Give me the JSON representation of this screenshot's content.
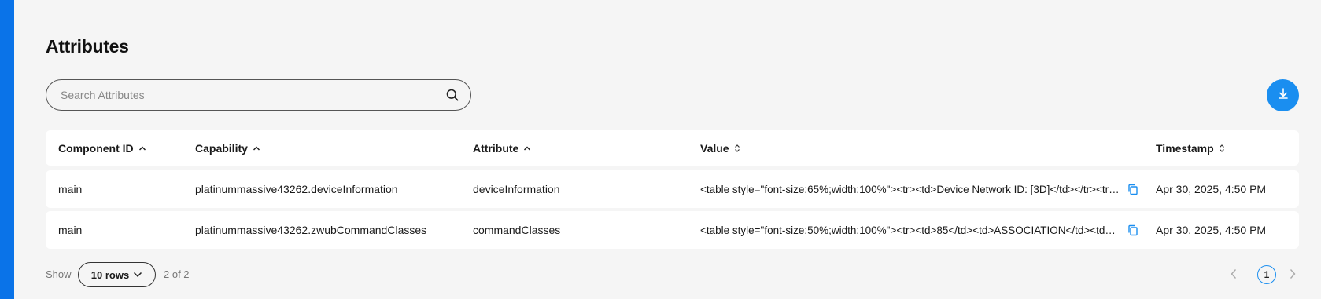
{
  "page": {
    "title": "Attributes"
  },
  "search": {
    "placeholder": "Search Attributes",
    "value": ""
  },
  "table": {
    "columns": [
      {
        "label": "Component ID",
        "sort": "ascending"
      },
      {
        "label": "Capability",
        "sort": "ascending"
      },
      {
        "label": "Attribute",
        "sort": "ascending"
      },
      {
        "label": "Value",
        "sort": "unsorted"
      },
      {
        "label": "Timestamp",
        "sort": "unsorted"
      }
    ],
    "rows": [
      {
        "component_id": "main",
        "capability": "platinummassive43262.deviceInformation",
        "attribute": "deviceInformation",
        "value": "<table style=\"font-size:65%;width:100%\"><tr><td>Device Network ID: [3D]</td></tr><tr><td>Z-Wave Version...",
        "timestamp": "Apr 30, 2025, 4:50 PM"
      },
      {
        "component_id": "main",
        "capability": "platinummassive43262.zwubCommandClasses",
        "attribute": "commandClasses",
        "value": "<table style=\"font-size:50%;width:100%\"><tr><td>85</td><td>ASSOCIATION</td><td>V2</td></tr>...",
        "timestamp": "Apr 30, 2025, 4:50 PM"
      }
    ]
  },
  "footer": {
    "show_label": "Show",
    "rows_per_page": "10 rows",
    "count_label": "2 of 2",
    "current_page": "1"
  },
  "colors": {
    "accent": "#1a8ef0",
    "left_bar": "#0a73e8",
    "background": "#f5f5f5"
  },
  "icons": [
    "search-icon",
    "download-icon",
    "sort-asc-icon",
    "sort-both-icon",
    "copy-icon",
    "chevron-down-icon",
    "chevron-left-icon",
    "chevron-right-icon"
  ]
}
